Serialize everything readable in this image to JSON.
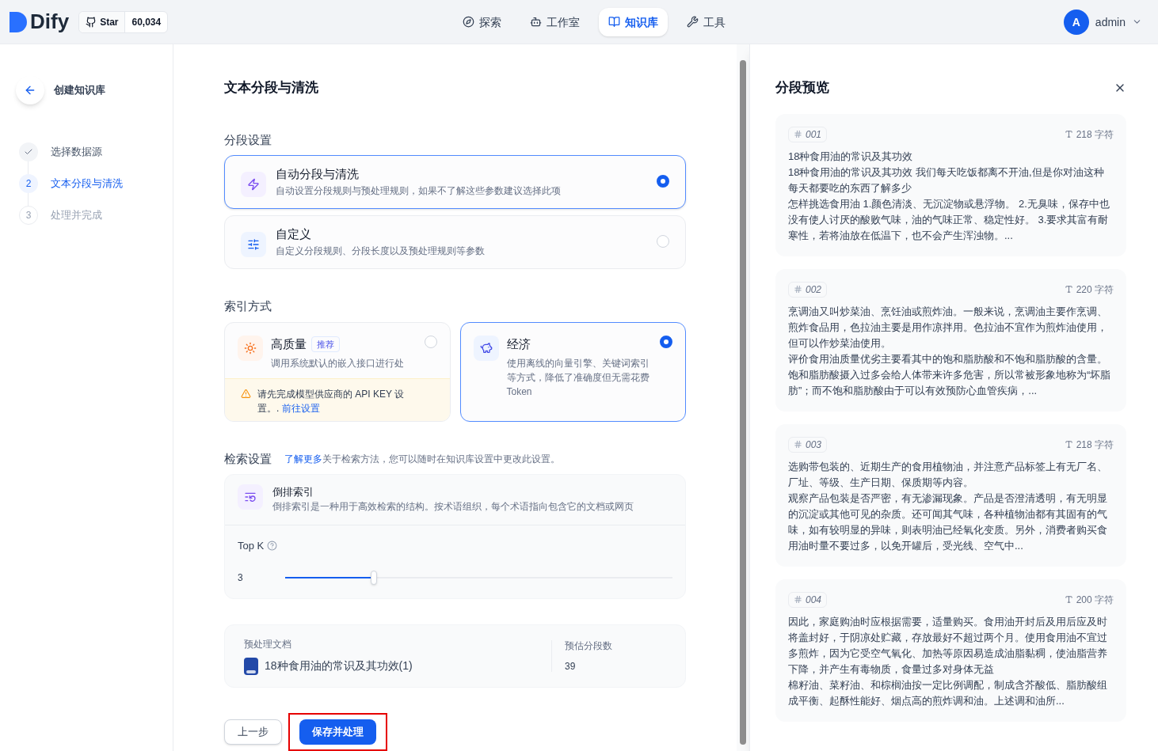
{
  "nav": {
    "logo": "Dify",
    "github": {
      "label": "Star",
      "count": "60,034"
    },
    "items": [
      {
        "label": "探索",
        "selected": false
      },
      {
        "label": "工作室",
        "selected": false
      },
      {
        "label": "知识库",
        "selected": true
      },
      {
        "label": "工具",
        "selected": false
      }
    ],
    "user": {
      "initial": "A",
      "name": "admin"
    }
  },
  "sidebar": {
    "title": "创建知识库",
    "steps": [
      {
        "label": "选择数据源",
        "completed": true,
        "selected": false
      },
      {
        "number": "2",
        "label": "文本分段与清洗",
        "completed": false,
        "selected": true
      },
      {
        "number": "3",
        "label": "处理并完成",
        "completed": false,
        "selected": false
      }
    ]
  },
  "main": {
    "title": "文本分段与清洗",
    "segmentation": {
      "label": "分段设置",
      "options": [
        {
          "title": "自动分段与清洗",
          "description": "自动设置分段规则与预处理规则，如果不了解这些参数建议选择此项",
          "selected": true
        },
        {
          "title": "自定义",
          "description": "自定义分段规则、分段长度以及预处理规则等参数",
          "selected": false
        }
      ]
    },
    "index": {
      "label": "索引方式",
      "options": [
        {
          "title": "高质量",
          "badge": "推荐",
          "description": "调用系统默认的嵌入接口进行处",
          "selected": false,
          "warning": {
            "text": "请先完成模型供应商的 API KEY 设置。.",
            "link": "前往设置"
          }
        },
        {
          "title": "经济",
          "description": "使用离线的向量引擎、关键词索引等方式，降低了准确度但无需花费 Token",
          "selected": true
        }
      ]
    },
    "retrieval": {
      "label": "检索设置",
      "link": "了解更多",
      "note": "关于检索方法，您可以随时在知识库设置中更改此设置。",
      "method": {
        "title": "倒排索引",
        "description": "倒排索引是一种用于高效检索的结构。按术语组织，每个术语指向包含它的文档或网页"
      },
      "top_k": {
        "label": "Top K",
        "value": "3",
        "level": 0.23
      }
    },
    "summary": {
      "doc_label": "预处理文档",
      "doc_name": "18种食用油的常识及其功效(1)",
      "count_label": "预估分段数",
      "count": "39"
    },
    "buttons": [
      {
        "label": "上一步",
        "kind": "secondary",
        "highlighted": false
      },
      {
        "label": "保存并处理",
        "kind": "primary",
        "highlighted": true
      }
    ]
  },
  "preview": {
    "title": "分段预览",
    "chunks": [
      {
        "number": "001",
        "chars": "218 字符",
        "paragraphs": [
          "18种食用油的常识及其功效",
          "18种食用油的常识及其功效 我们每天吃饭都离不开油,但是你对油这种每天都要吃的东西了解多少",
          "怎样挑选食用油 1.颜色清淡、无沉淀物或悬浮物。 2.无臭味，保存中也没有使人讨厌的酸败气味，油的气味正常、稳定性好。 3.要求其富有耐寒性，若将油放在低温下，也不会产生浑浊物。..."
        ]
      },
      {
        "number": "002",
        "chars": "220 字符",
        "paragraphs": [
          "烹调油又叫炒菜油、烹饪油或煎炸油。一般来说，烹调油主要作烹调、煎炸食品用，色拉油主要是用作凉拌用。色拉油不宜作为煎炸油使用，但可以作炒菜油使用。",
          "评价食用油质量优劣主要看其中的饱和脂肪酸和不饱和脂肪酸的含量。饱和脂肪酸摄入过多会给人体带来许多危害，所以常被形象地称为“坏脂肪”；而不饱和脂肪酸由于可以有效预防心血管疾病，..."
        ]
      },
      {
        "number": "003",
        "chars": "218 字符",
        "paragraphs": [
          "选购带包装的、近期生产的食用植物油，并注意产品标签上有无厂名、厂址、等级、生产日期、保质期等内容。",
          "观察产品包装是否严密，有无渗漏现象。产品是否澄清透明，有无明显的沉淀或其他可见的杂质。还可闻其气味，各种植物油都有其固有的气味，如有较明显的异味，则表明油已经氧化变质。另外，消费者购买食用油时量不要过多，以免开罐后，受光线、空气中..."
        ]
      },
      {
        "number": "004",
        "chars": "200 字符",
        "paragraphs": [
          "因此，家庭购油时应根据需要，适量购买。食用油开封后及用后应及时将盖封好，于阴凉处贮藏，存放最好不超过两个月。使用食用油不宜过多煎炸，因为它受空气氧化、加热等原因易造成油脂黏稠，使油脂营养下降，并产生有毒物质，食量过多对身体无益",
          "棉籽油、菜籽油、和棕榈油按一定比例调配，制成含芥酸低、脂肪酸组成平衡、起酥性能好、烟点高的煎炸调和油。上述调和油所..."
        ]
      }
    ]
  }
}
